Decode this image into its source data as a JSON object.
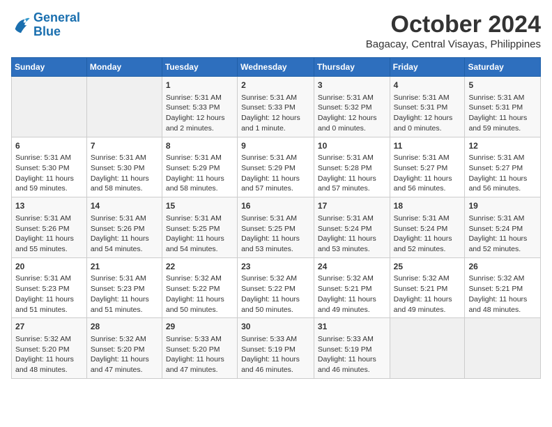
{
  "logo": {
    "line1": "General",
    "line2": "Blue"
  },
  "title": "October 2024",
  "location": "Bagacay, Central Visayas, Philippines",
  "headers": [
    "Sunday",
    "Monday",
    "Tuesday",
    "Wednesday",
    "Thursday",
    "Friday",
    "Saturday"
  ],
  "weeks": [
    [
      {
        "day": "",
        "info": ""
      },
      {
        "day": "",
        "info": ""
      },
      {
        "day": "1",
        "info": "Sunrise: 5:31 AM\nSunset: 5:33 PM\nDaylight: 12 hours and 2 minutes."
      },
      {
        "day": "2",
        "info": "Sunrise: 5:31 AM\nSunset: 5:33 PM\nDaylight: 12 hours and 1 minute."
      },
      {
        "day": "3",
        "info": "Sunrise: 5:31 AM\nSunset: 5:32 PM\nDaylight: 12 hours and 0 minutes."
      },
      {
        "day": "4",
        "info": "Sunrise: 5:31 AM\nSunset: 5:31 PM\nDaylight: 12 hours and 0 minutes."
      },
      {
        "day": "5",
        "info": "Sunrise: 5:31 AM\nSunset: 5:31 PM\nDaylight: 11 hours and 59 minutes."
      }
    ],
    [
      {
        "day": "6",
        "info": "Sunrise: 5:31 AM\nSunset: 5:30 PM\nDaylight: 11 hours and 59 minutes."
      },
      {
        "day": "7",
        "info": "Sunrise: 5:31 AM\nSunset: 5:30 PM\nDaylight: 11 hours and 58 minutes."
      },
      {
        "day": "8",
        "info": "Sunrise: 5:31 AM\nSunset: 5:29 PM\nDaylight: 11 hours and 58 minutes."
      },
      {
        "day": "9",
        "info": "Sunrise: 5:31 AM\nSunset: 5:29 PM\nDaylight: 11 hours and 57 minutes."
      },
      {
        "day": "10",
        "info": "Sunrise: 5:31 AM\nSunset: 5:28 PM\nDaylight: 11 hours and 57 minutes."
      },
      {
        "day": "11",
        "info": "Sunrise: 5:31 AM\nSunset: 5:27 PM\nDaylight: 11 hours and 56 minutes."
      },
      {
        "day": "12",
        "info": "Sunrise: 5:31 AM\nSunset: 5:27 PM\nDaylight: 11 hours and 56 minutes."
      }
    ],
    [
      {
        "day": "13",
        "info": "Sunrise: 5:31 AM\nSunset: 5:26 PM\nDaylight: 11 hours and 55 minutes."
      },
      {
        "day": "14",
        "info": "Sunrise: 5:31 AM\nSunset: 5:26 PM\nDaylight: 11 hours and 54 minutes."
      },
      {
        "day": "15",
        "info": "Sunrise: 5:31 AM\nSunset: 5:25 PM\nDaylight: 11 hours and 54 minutes."
      },
      {
        "day": "16",
        "info": "Sunrise: 5:31 AM\nSunset: 5:25 PM\nDaylight: 11 hours and 53 minutes."
      },
      {
        "day": "17",
        "info": "Sunrise: 5:31 AM\nSunset: 5:24 PM\nDaylight: 11 hours and 53 minutes."
      },
      {
        "day": "18",
        "info": "Sunrise: 5:31 AM\nSunset: 5:24 PM\nDaylight: 11 hours and 52 minutes."
      },
      {
        "day": "19",
        "info": "Sunrise: 5:31 AM\nSunset: 5:24 PM\nDaylight: 11 hours and 52 minutes."
      }
    ],
    [
      {
        "day": "20",
        "info": "Sunrise: 5:31 AM\nSunset: 5:23 PM\nDaylight: 11 hours and 51 minutes."
      },
      {
        "day": "21",
        "info": "Sunrise: 5:31 AM\nSunset: 5:23 PM\nDaylight: 11 hours and 51 minutes."
      },
      {
        "day": "22",
        "info": "Sunrise: 5:32 AM\nSunset: 5:22 PM\nDaylight: 11 hours and 50 minutes."
      },
      {
        "day": "23",
        "info": "Sunrise: 5:32 AM\nSunset: 5:22 PM\nDaylight: 11 hours and 50 minutes."
      },
      {
        "day": "24",
        "info": "Sunrise: 5:32 AM\nSunset: 5:21 PM\nDaylight: 11 hours and 49 minutes."
      },
      {
        "day": "25",
        "info": "Sunrise: 5:32 AM\nSunset: 5:21 PM\nDaylight: 11 hours and 49 minutes."
      },
      {
        "day": "26",
        "info": "Sunrise: 5:32 AM\nSunset: 5:21 PM\nDaylight: 11 hours and 48 minutes."
      }
    ],
    [
      {
        "day": "27",
        "info": "Sunrise: 5:32 AM\nSunset: 5:20 PM\nDaylight: 11 hours and 48 minutes."
      },
      {
        "day": "28",
        "info": "Sunrise: 5:32 AM\nSunset: 5:20 PM\nDaylight: 11 hours and 47 minutes."
      },
      {
        "day": "29",
        "info": "Sunrise: 5:33 AM\nSunset: 5:20 PM\nDaylight: 11 hours and 47 minutes."
      },
      {
        "day": "30",
        "info": "Sunrise: 5:33 AM\nSunset: 5:19 PM\nDaylight: 11 hours and 46 minutes."
      },
      {
        "day": "31",
        "info": "Sunrise: 5:33 AM\nSunset: 5:19 PM\nDaylight: 11 hours and 46 minutes."
      },
      {
        "day": "",
        "info": ""
      },
      {
        "day": "",
        "info": ""
      }
    ]
  ]
}
